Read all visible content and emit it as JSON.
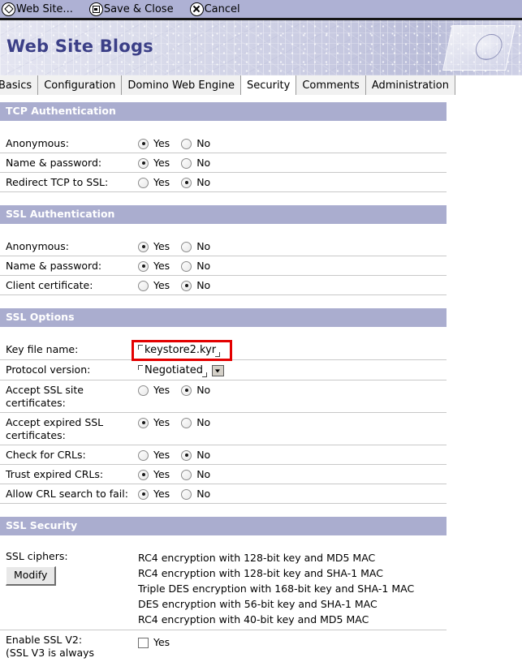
{
  "toolbar": {
    "items": [
      {
        "label": "Web Site...",
        "icon": "diamond-icon"
      },
      {
        "label": "Save & Close",
        "icon": "save-disk-icon"
      },
      {
        "label": "Cancel",
        "icon": "cancel-x-icon"
      }
    ]
  },
  "banner": {
    "title": "Web Site Blogs"
  },
  "tabs": [
    {
      "label": "Basics",
      "active": false
    },
    {
      "label": "Configuration",
      "active": false
    },
    {
      "label": "Domino Web Engine",
      "active": false
    },
    {
      "label": "Security",
      "active": true
    },
    {
      "label": "Comments",
      "active": false
    },
    {
      "label": "Administration",
      "active": false
    }
  ],
  "yes_label": "Yes",
  "no_label": "No",
  "sections": {
    "tcp_auth": {
      "title": "TCP Authentication",
      "rows": [
        {
          "label": "Anonymous:",
          "value": "Yes"
        },
        {
          "label": "Name & password:",
          "value": "Yes"
        },
        {
          "label": "Redirect TCP to SSL:",
          "value": "No"
        }
      ]
    },
    "ssl_auth": {
      "title": "SSL Authentication",
      "rows": [
        {
          "label": "Anonymous:",
          "value": "Yes"
        },
        {
          "label": "Name & password:",
          "value": "Yes"
        },
        {
          "label": "Client certificate:",
          "value": "No"
        }
      ]
    },
    "ssl_options": {
      "title": "SSL Options",
      "key_file_label": "Key file name:",
      "key_file_value": "keystore2.kyr",
      "protocol_label": "Protocol version:",
      "protocol_value": "Negotiated",
      "rows": [
        {
          "label": "Accept SSL site certificates:",
          "value": "No"
        },
        {
          "label": "Accept expired SSL certificates:",
          "value": "Yes"
        },
        {
          "label": "Check for CRLs:",
          "value": "No"
        },
        {
          "label": "Trust expired CRLs:",
          "value": "Yes"
        },
        {
          "label": "Allow CRL search to fail:",
          "value": "Yes"
        }
      ]
    },
    "ssl_security": {
      "title": "SSL Security",
      "ciphers_label": "SSL ciphers:",
      "modify_label": "Modify",
      "ciphers": [
        "RC4 encryption with 128-bit key and MD5 MAC",
        "RC4 encryption with 128-bit key and SHA-1 MAC",
        "Triple DES encryption with 168-bit key and SHA-1 MAC",
        "DES encryption with 56-bit key and SHA-1 MAC",
        "RC4 encryption with 40-bit key and MD5 MAC"
      ],
      "ssl_v2_label_line1": "Enable SSL V2:",
      "ssl_v2_label_line2": "(SSL V3 is always",
      "ssl_v2_value_label": "Yes",
      "ssl_v2_checked": false
    }
  },
  "colors": {
    "toolbar_bg": "#aeb1d4",
    "section_header_bg": "#aaadcf",
    "banner_title": "#3b3f87",
    "highlight_red": "#e30000"
  }
}
